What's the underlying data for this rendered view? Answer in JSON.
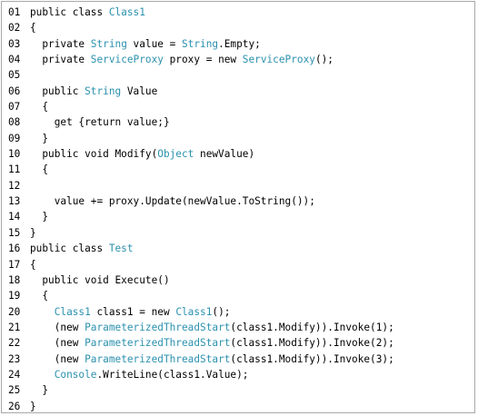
{
  "colors": {
    "keyword": "#000000",
    "type": "#2b91af",
    "text": "#000000",
    "border": "#a8a8a8"
  },
  "lines": [
    {
      "num": "01",
      "segments": [
        {
          "text": "public class ",
          "kind": "plain"
        },
        {
          "text": "Class1",
          "kind": "type"
        }
      ]
    },
    {
      "num": "02",
      "segments": [
        {
          "text": "{",
          "kind": "plain"
        }
      ]
    },
    {
      "num": "03",
      "segments": [
        {
          "text": "  private ",
          "kind": "plain"
        },
        {
          "text": "String",
          "kind": "type"
        },
        {
          "text": " value = ",
          "kind": "plain"
        },
        {
          "text": "String",
          "kind": "type"
        },
        {
          "text": ".Empty;",
          "kind": "plain"
        }
      ]
    },
    {
      "num": "04",
      "segments": [
        {
          "text": "  private ",
          "kind": "plain"
        },
        {
          "text": "ServiceProxy",
          "kind": "type"
        },
        {
          "text": " proxy = new ",
          "kind": "plain"
        },
        {
          "text": "ServiceProxy",
          "kind": "type"
        },
        {
          "text": "();",
          "kind": "plain"
        }
      ]
    },
    {
      "num": "05",
      "segments": []
    },
    {
      "num": "06",
      "segments": [
        {
          "text": "  public ",
          "kind": "plain"
        },
        {
          "text": "String",
          "kind": "type"
        },
        {
          "text": " Value",
          "kind": "plain"
        }
      ]
    },
    {
      "num": "07",
      "segments": [
        {
          "text": "  {",
          "kind": "plain"
        }
      ]
    },
    {
      "num": "08",
      "segments": [
        {
          "text": "    get {return value;}",
          "kind": "plain"
        }
      ]
    },
    {
      "num": "09",
      "segments": [
        {
          "text": "  }",
          "kind": "plain"
        }
      ]
    },
    {
      "num": "10",
      "segments": [
        {
          "text": "  public void Modify(",
          "kind": "plain"
        },
        {
          "text": "Object",
          "kind": "type"
        },
        {
          "text": " newValue)",
          "kind": "plain"
        }
      ]
    },
    {
      "num": "11",
      "segments": [
        {
          "text": "  {",
          "kind": "plain"
        }
      ]
    },
    {
      "num": "12",
      "segments": []
    },
    {
      "num": "13",
      "segments": [
        {
          "text": "    value += proxy.Update(newValue.ToString());",
          "kind": "plain"
        }
      ]
    },
    {
      "num": "14",
      "segments": [
        {
          "text": "  }",
          "kind": "plain"
        }
      ]
    },
    {
      "num": "15",
      "segments": [
        {
          "text": "}",
          "kind": "plain"
        }
      ]
    },
    {
      "num": "16",
      "segments": [
        {
          "text": "public class ",
          "kind": "plain"
        },
        {
          "text": "Test",
          "kind": "type"
        }
      ]
    },
    {
      "num": "17",
      "segments": [
        {
          "text": "{",
          "kind": "plain"
        }
      ]
    },
    {
      "num": "18",
      "segments": [
        {
          "text": "  public void Execute()",
          "kind": "plain"
        }
      ]
    },
    {
      "num": "19",
      "segments": [
        {
          "text": "  {",
          "kind": "plain"
        }
      ]
    },
    {
      "num": "20",
      "segments": [
        {
          "text": "    ",
          "kind": "plain"
        },
        {
          "text": "Class1",
          "kind": "type"
        },
        {
          "text": " class1 = new ",
          "kind": "plain"
        },
        {
          "text": "Class1",
          "kind": "type"
        },
        {
          "text": "();",
          "kind": "plain"
        }
      ]
    },
    {
      "num": "21",
      "segments": [
        {
          "text": "    (new ",
          "kind": "plain"
        },
        {
          "text": "ParameterizedThreadStart",
          "kind": "type"
        },
        {
          "text": "(class1.Modify)).Invoke(1);",
          "kind": "plain"
        }
      ]
    },
    {
      "num": "22",
      "segments": [
        {
          "text": "    (new ",
          "kind": "plain"
        },
        {
          "text": "ParameterizedThreadStart",
          "kind": "type"
        },
        {
          "text": "(class1.Modify)).Invoke(2);",
          "kind": "plain"
        }
      ]
    },
    {
      "num": "23",
      "segments": [
        {
          "text": "    (new ",
          "kind": "plain"
        },
        {
          "text": "ParameterizedThreadStart",
          "kind": "type"
        },
        {
          "text": "(class1.Modify)).Invoke(3);",
          "kind": "plain"
        }
      ]
    },
    {
      "num": "24",
      "segments": [
        {
          "text": "    ",
          "kind": "plain"
        },
        {
          "text": "Console",
          "kind": "type"
        },
        {
          "text": ".WriteLine(class1.Value);",
          "kind": "plain"
        }
      ]
    },
    {
      "num": "25",
      "segments": [
        {
          "text": "  }",
          "kind": "plain"
        }
      ]
    },
    {
      "num": "26",
      "segments": [
        {
          "text": "}",
          "kind": "plain"
        }
      ]
    }
  ]
}
